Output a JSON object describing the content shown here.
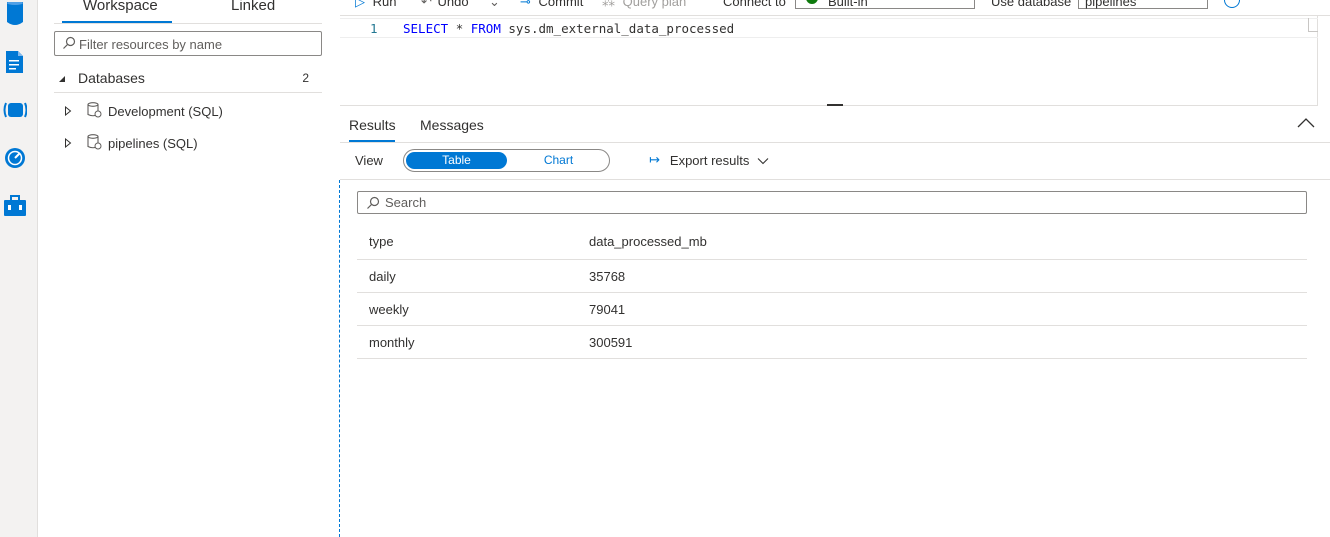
{
  "explorer": {
    "tabs": [
      "Workspace",
      "Linked"
    ],
    "filter_placeholder": "Filter resources by name",
    "databases": {
      "label": "Databases",
      "count": "2"
    },
    "items": [
      {
        "label": "Development (SQL)"
      },
      {
        "label": "pipelines (SQL)"
      }
    ]
  },
  "toolbar": {
    "run": "Run",
    "undo": "Undo",
    "commit": "Commit",
    "query_plan": "Query plan",
    "connect_to_label": "Connect to",
    "connect_to_value": "Built-in",
    "use_database_label": "Use database",
    "use_database_value": "pipelines"
  },
  "editor": {
    "line_number": "1",
    "kw_select": "SELECT",
    "star": "*",
    "kw_from": "FROM",
    "object": "sys.dm_external_data_processed"
  },
  "results": {
    "tabs": [
      "Results",
      "Messages"
    ],
    "view_label": "View",
    "view_options": [
      "Table",
      "Chart"
    ],
    "export_label": "Export results",
    "search_placeholder": "Search",
    "columns": [
      "type",
      "data_processed_mb"
    ],
    "rows": [
      [
        "daily",
        "35768"
      ],
      [
        "weekly",
        "79041"
      ],
      [
        "monthly",
        "300591"
      ]
    ]
  },
  "colors": {
    "accent": "#0078d4",
    "status_ok": "#0e7a0d"
  }
}
